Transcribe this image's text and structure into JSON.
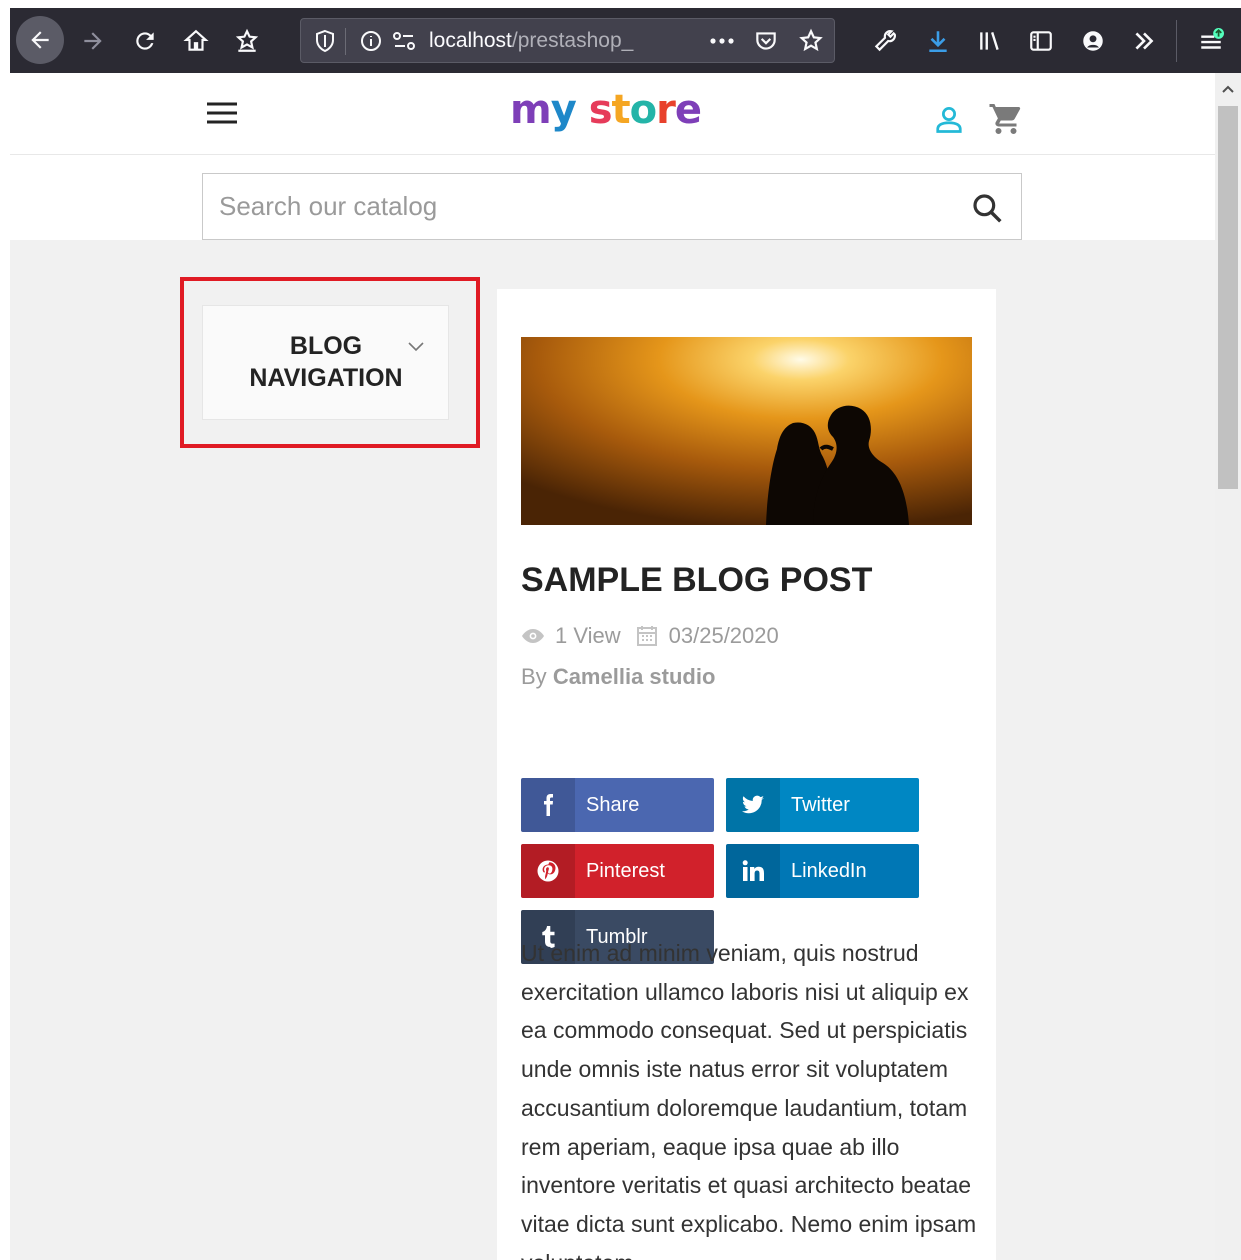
{
  "browser": {
    "url_host": "localhost",
    "url_path": "/prestashop_",
    "icons": [
      "back-icon",
      "forward-icon",
      "reload-icon",
      "home-icon",
      "bookmark-manager-icon",
      "shield-icon",
      "info-icon",
      "permissions-icon",
      "more-icon",
      "pocket-icon",
      "star-icon",
      "wrench-icon",
      "download-icon",
      "library-icon",
      "sidebar-icon",
      "account-icon",
      "overflow-icon",
      "menu-icon"
    ]
  },
  "header": {
    "logo_parts": [
      "m",
      "y",
      " ",
      "s",
      "t",
      "o",
      "r",
      "e"
    ],
    "logo_text": "my store"
  },
  "search": {
    "placeholder": "Search our catalog"
  },
  "sidebar": {
    "title": "BLOG NAVIGATION"
  },
  "post": {
    "title": "SAMPLE BLOG POST",
    "views": "1 View",
    "date": "03/25/2020",
    "author_prefix": "By",
    "author": "Camellia studio",
    "share_buttons": [
      {
        "label": "Share",
        "color": "#3b5998",
        "icon": "facebook-icon"
      },
      {
        "label": "Twitter",
        "color": "#0087c3",
        "icon": "twitter-icon"
      },
      {
        "label": "Pinterest",
        "color": "#cb2027",
        "icon": "pinterest-icon"
      },
      {
        "label": "LinkedIn",
        "color": "#0077b5",
        "icon": "linkedin-icon"
      },
      {
        "label": "Tumblr",
        "color": "#35465c",
        "icon": "tumblr-icon"
      }
    ],
    "body": "Ut enim ad minim veniam, quis nostrud exercitation ullamco laboris nisi ut aliquip ex ea commodo consequat. Sed ut perspiciatis unde omnis iste natus error sit voluptatem accusantium doloremque laudantium, totam rem aperiam, eaque ipsa quae ab illo inventore veritatis et quasi architecto beatae vitae dicta sunt explicabo. Nemo enim ipsam voluptatem"
  },
  "colors": {
    "toolbar": "#2b2a33",
    "highlight": "#e01b24",
    "page_bg": "#f1f1f1"
  }
}
